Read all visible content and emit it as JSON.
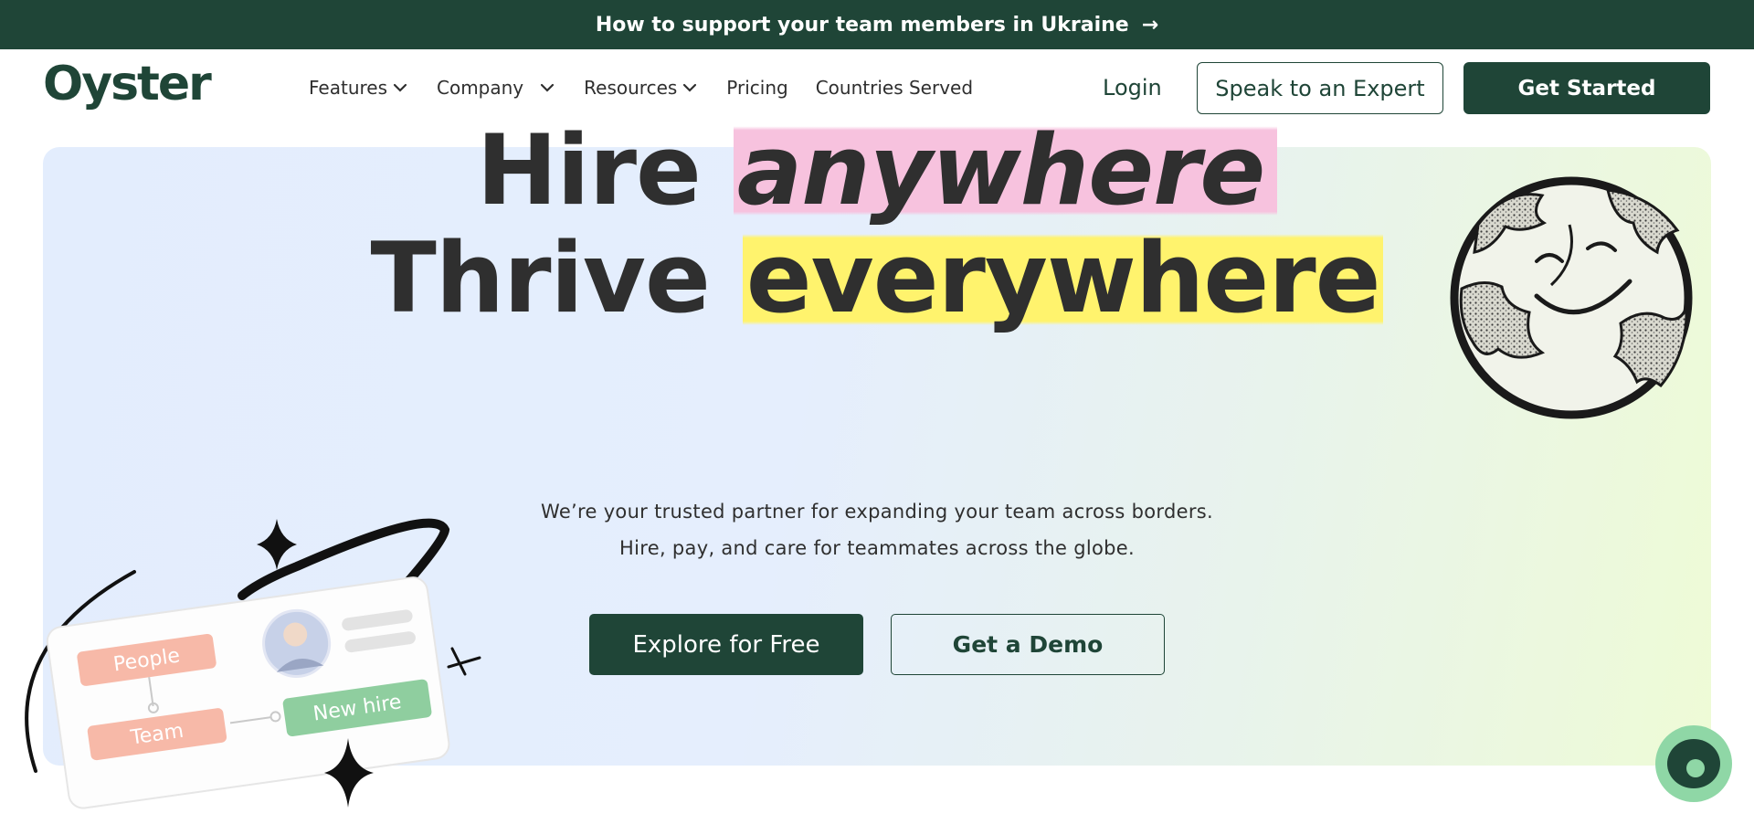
{
  "banner": {
    "text": "How to support your team members in Ukraine",
    "arrow": "→"
  },
  "nav": {
    "logo": "Oyster",
    "menu": [
      {
        "label": "Features",
        "icon": "chevron-down-icon"
      },
      {
        "label": "Company",
        "icon": "chevron-down-icon"
      },
      {
        "label": "Resources",
        "icon": "chevron-down-icon"
      },
      {
        "label": "Pricing"
      },
      {
        "label": "Countries Served"
      }
    ],
    "login": "Login",
    "expert_button": "Speak to an Expert",
    "started_button": "Get Started"
  },
  "hero": {
    "line1_plain": "Hire ",
    "line1_accent": "anywhere",
    "line2_plain": "Thrive ",
    "line2_accent": "everywhere",
    "subtitle_1": "We’re your trusted partner for expanding your team across borders.",
    "subtitle_2": "Hire, pay, and care for teammates across the globe.",
    "explore_button": "Explore for Free",
    "demo_button": "Get a Demo"
  },
  "illustration": {
    "tag_people": "People",
    "tag_team": "Team",
    "tag_new_hire": "New hire"
  },
  "colors": {
    "brand_dark": "#1f4537",
    "highlight_pink": "#f7c2de",
    "highlight_yellow": "#fff36d",
    "tag_salmon": "#f7b9a8",
    "tag_green": "#8fce9f",
    "chat_green": "#8fd7a6"
  },
  "icons": [
    "arrow-right-icon",
    "chevron-down-icon",
    "globe-smiley-icon",
    "sparkle-icon",
    "chat-icon"
  ]
}
